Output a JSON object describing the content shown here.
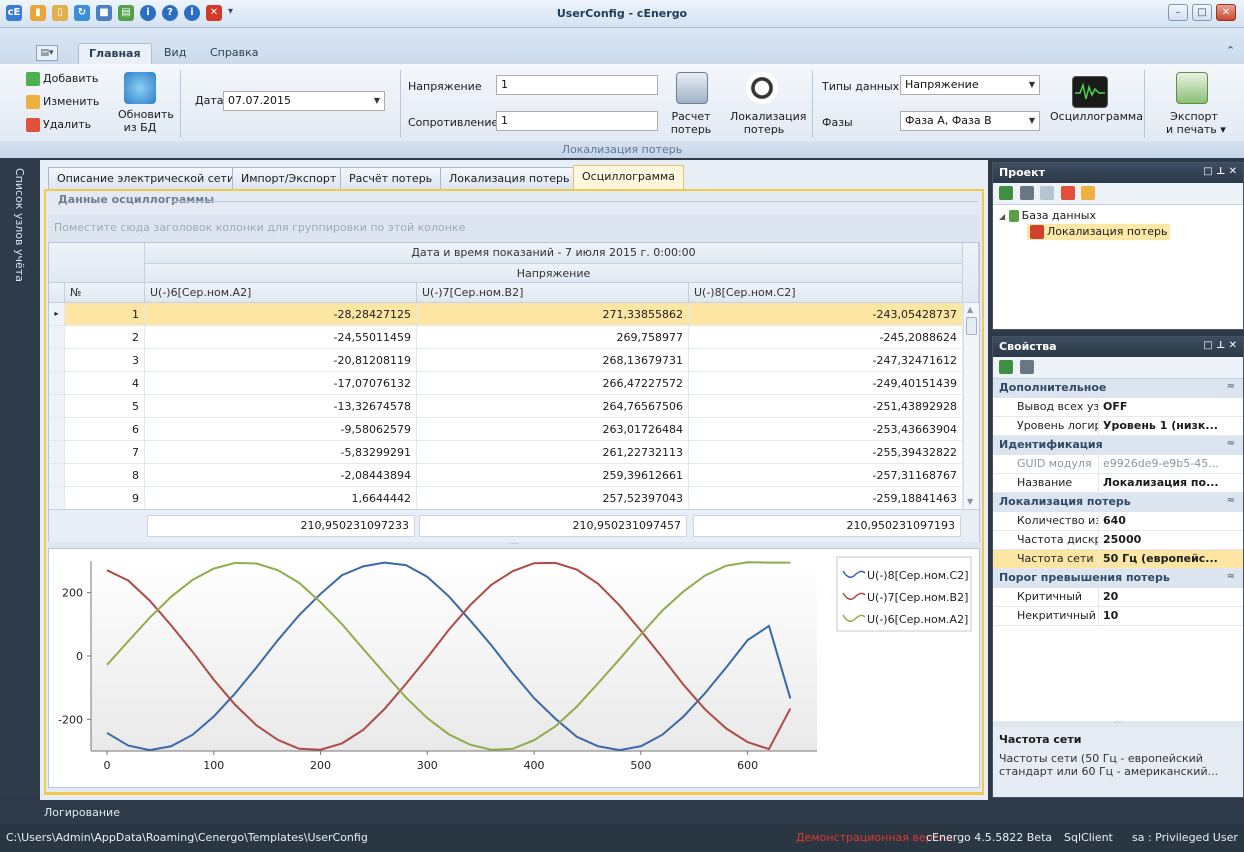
{
  "window": {
    "title": "UserConfig - cEnergo"
  },
  "ribbon_tabs": [
    {
      "label": "Главная"
    },
    {
      "label": "Вид"
    },
    {
      "label": "Справка"
    }
  ],
  "ribbon": {
    "add_label": "Добавить",
    "edit_label": "Изменить",
    "delete_label": "Удалить",
    "refresh_label_1": "Обновить",
    "refresh_label_2": "из БД",
    "date_label": "Дата",
    "date_value": "07.07.2015",
    "voltage_label": "Напряжение",
    "voltage_value": "1",
    "resistance_label": "Сопротивление",
    "resistance_value": "1",
    "calc_label_1": "Расчет",
    "calc_label_2": "потерь",
    "loc_label_1": "Локализация",
    "loc_label_2": "потерь",
    "datatype_label": "Типы данных",
    "datatype_value": "Напряжение",
    "phases_label": "Фазы",
    "phases_value": "Фаза А, Фаза В",
    "osc_label": "Осциллограмма",
    "export_label_1": "Экспорт",
    "export_label_2": "и печать",
    "group_caption": "Локализация потерь"
  },
  "left_strip": {
    "label": "Список узлов учёта"
  },
  "doc_tabs": [
    {
      "label": "Описание электрической сети"
    },
    {
      "label": "Импорт/Экспорт"
    },
    {
      "label": "Расчёт потерь"
    },
    {
      "label": "Локализация потерь"
    },
    {
      "label": "Осциллограмма"
    }
  ],
  "osc_group": {
    "title": "Данные осциллограммы",
    "group_hint": "Поместите сюда заголовок колонки для группировки по этой колонке"
  },
  "grid": {
    "band_top": "Дата и время показаний - 7 июля 2015 г. 0:00:00",
    "band_sub": "Напряжение",
    "col_num": "№",
    "cols": [
      "U(-)6[Сер.ном.А2]",
      "U(-)7[Сер.ном.В2]",
      "U(-)8[Сер.ном.С2]"
    ],
    "rows": [
      {
        "n": "1",
        "a": "-28,28427125",
        "b": "271,33855862",
        "c": "-243,05428737"
      },
      {
        "n": "2",
        "a": "-24,55011459",
        "b": "269,758977",
        "c": "-245,2088624"
      },
      {
        "n": "3",
        "a": "-20,81208119",
        "b": "268,13679731",
        "c": "-247,32471612"
      },
      {
        "n": "4",
        "a": "-17,07076132",
        "b": "266,47227572",
        "c": "-249,40151439"
      },
      {
        "n": "5",
        "a": "-13,32674578",
        "b": "264,76567506",
        "c": "-251,43892928"
      },
      {
        "n": "6",
        "a": "-9,58062579",
        "b": "263,01726484",
        "c": "-253,43663904"
      },
      {
        "n": "7",
        "a": "-5,83299291",
        "b": "261,22732113",
        "c": "-255,39432822"
      },
      {
        "n": "8",
        "a": "-2,08443894",
        "b": "259,39612661",
        "c": "-257,31168767"
      },
      {
        "n": "9",
        "a": "1,6644442",
        "b": "257,52397043",
        "c": "-259,18841463"
      }
    ],
    "totals": [
      "210,950231097233",
      "210,950231097457",
      "210,950231097193"
    ]
  },
  "chart_data": {
    "type": "line",
    "x": [
      0,
      20,
      40,
      60,
      80,
      100,
      120,
      140,
      160,
      180,
      200,
      220,
      240,
      260,
      280,
      300,
      320,
      340,
      360,
      380,
      400,
      420,
      440,
      460,
      480,
      500,
      520,
      540,
      560,
      580,
      600,
      620,
      640
    ],
    "series": [
      {
        "name": "U(-)8[Сер.ном.С2]",
        "color": "#3a68a8",
        "values": [
          -243,
          -283,
          -297,
          -285,
          -249,
          -191,
          -118,
          -36,
          50,
          129,
          196,
          255,
          283,
          295,
          287,
          250,
          189,
          113,
          34,
          -53,
          -133,
          -198,
          -255,
          -285,
          -297,
          -285,
          -249,
          -191,
          -118,
          -36,
          50,
          95,
          -134
        ]
      },
      {
        "name": "U(-)7[Сер.ном.В2]",
        "color": "#b04a45",
        "values": [
          271,
          238,
          175,
          97,
          14,
          -75,
          -154,
          -219,
          -265,
          -293,
          -296,
          -276,
          -233,
          -167,
          -88,
          -5,
          82,
          160,
          225,
          268,
          293,
          294,
          273,
          228,
          160,
          80,
          -4,
          -91,
          -168,
          -229,
          -272,
          -294,
          -166
        ]
      },
      {
        "name": "U(-)6[Сер.ном.А2]",
        "color": "#8fae4b",
        "values": [
          -28,
          47,
          121,
          187,
          240,
          276,
          294,
          292,
          271,
          231,
          170,
          101,
          22,
          -55,
          -131,
          -196,
          -247,
          -280,
          -296,
          -293,
          -266,
          -222,
          -160,
          -86,
          -10,
          68,
          143,
          204,
          254,
          285,
          296,
          295,
          295
        ]
      }
    ],
    "yticks": [
      "200",
      "0",
      "-200"
    ],
    "xticks": [
      "0",
      "100",
      "200",
      "300",
      "400",
      "500",
      "600"
    ],
    "ylim": [
      -300,
      300
    ],
    "xlim": [
      -15,
      665
    ],
    "legend": "top-right"
  },
  "project_panel": {
    "title": "Проект",
    "tree_root": "База данных",
    "tree_child": "Локализация потерь"
  },
  "props_panel": {
    "title": "Свойства",
    "categories": [
      {
        "name": "Дополнительное",
        "rows": [
          {
            "name": "Вывод всех узл",
            "value": "OFF"
          },
          {
            "name": "Уровень логирс",
            "value": "Уровень 1 (низк..."
          }
        ]
      },
      {
        "name": "Идентификация",
        "rows": [
          {
            "name": "GUID модуля",
            "value": "e9926de9-e9b5-45..."
          },
          {
            "name": "Название",
            "value": "Локализация по..."
          }
        ]
      },
      {
        "name": "Локализация потерь",
        "rows": [
          {
            "name": "Количество изм",
            "value": "640"
          },
          {
            "name": "Частота дискре",
            "value": "25000"
          },
          {
            "name": "Частота сети",
            "value": "50 Гц (европейс..."
          }
        ]
      },
      {
        "name": "Порог превышения потерь",
        "rows": [
          {
            "name": "Критичный",
            "value": "20"
          },
          {
            "name": "Некритичный",
            "value": "10"
          }
        ]
      }
    ],
    "desc_title": "Частота сети",
    "desc_text": "Частоты сети (50 Гц - европейский стандарт или 60 Гц - американский..."
  },
  "logbar": {
    "label": "Логирование"
  },
  "status": {
    "path": "C:\\Users\\Admin\\AppData\\Roaming\\Cenergo\\Templates\\UserConfig",
    "demo": "Демонстрационная версия",
    "version": "cEnergo 4.5.5822 Beta",
    "client": "SqlClient",
    "user": "sa : Privileged User"
  }
}
